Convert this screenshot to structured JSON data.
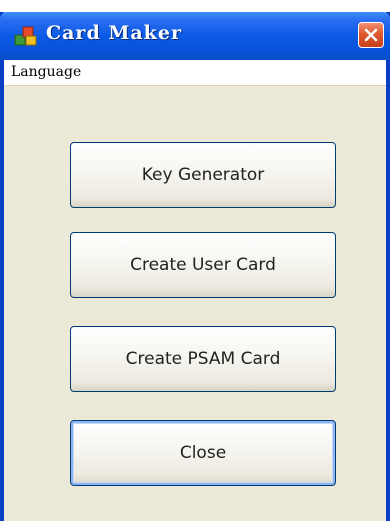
{
  "window": {
    "title": "Card Maker"
  },
  "menu": {
    "items": [
      {
        "label": "Language"
      }
    ]
  },
  "buttons": [
    {
      "label": "Key Generator"
    },
    {
      "label": "Create User Card"
    },
    {
      "label": "Create PSAM Card"
    },
    {
      "label": "Close"
    }
  ],
  "icons": {
    "app": "app-logo-icon",
    "close": "close-icon"
  },
  "colors": {
    "titlebar": "#0a5ae6",
    "close_button": "#e05a30",
    "window_body": "#ece9d8",
    "button_border": "#003c74"
  }
}
